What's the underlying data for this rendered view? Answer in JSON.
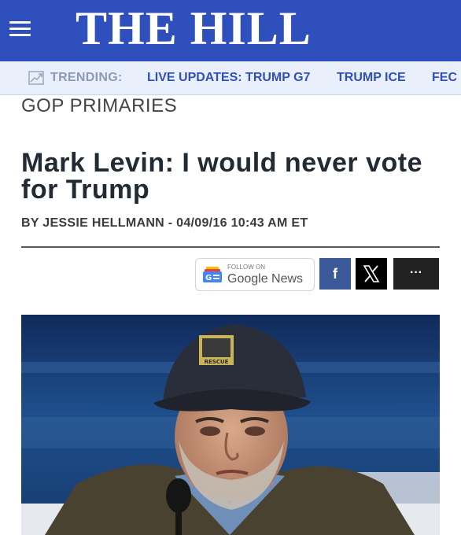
{
  "header": {
    "logo": "THE HILL",
    "menu_icon": "hamburger-menu-icon"
  },
  "trending": {
    "icon": "trending-chart-icon",
    "label": "TRENDING:",
    "links": [
      "LIVE UPDATES: TRUMP G7",
      "TRUMP ICE",
      "FEC"
    ]
  },
  "article": {
    "section": "GOP PRIMARIES",
    "title": "Mark Levin: I would never vote for Trump",
    "byline": "BY JESSIE HELLMANN - 04/09/16 10:43 AM ET",
    "cap_patch_text": "RESCUE"
  },
  "share": {
    "google_news_follow": "FOLLOW ON",
    "google_news_name": "Google News",
    "facebook_glyph": "f",
    "more_glyph": "···",
    "icons": [
      "google-news-icon",
      "facebook-icon",
      "x-icon",
      "more-icon"
    ]
  },
  "colors": {
    "brand_blue": "#2f4fbd",
    "trending_bg": "#eaf0fb",
    "facebook_blue": "#3b5998",
    "headline_text": "#222a33"
  }
}
